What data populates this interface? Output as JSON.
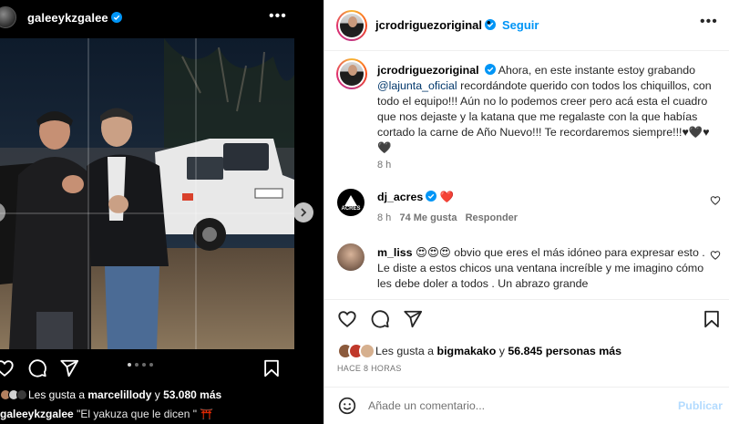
{
  "colors": {
    "link": "#0095f6",
    "heart": "#ed4956",
    "text_secondary": "#737373",
    "mention": "#00376b"
  },
  "left_post": {
    "username": "galeeykzgalee",
    "verified": true,
    "more_icon": "more-horizontal-icon",
    "likes_prefix": "Les gusta a",
    "likes_user": "marcelillody",
    "likes_mid": "y",
    "likes_count": "53.080 más",
    "caption_user": "galeeykzgalee",
    "caption_text": "\"El yakuza que le dicen \" ⛩️",
    "icons": [
      "heart-icon",
      "comment-icon",
      "share-icon",
      "bookmark-icon"
    ]
  },
  "post": {
    "username": "jcrodriguezoriginal",
    "verified": true,
    "separator": "•",
    "follow_label": "Seguir",
    "more_icon": "more-horizontal-icon",
    "caption_user": "jcrodriguezoriginal",
    "caption_part1": "Ahora, en este instante estoy grabando",
    "caption_mention": "@lajunta_oficial",
    "caption_part2": "recordándote querido con todos los chiquillos, con todo el equipo!!! Aún no lo podemos creer pero acá esta el cuadro que nos dejaste y la katana que me regalaste con la que habías cortado la carne de Año Nuevo!!! Te recordaremos siempre!!!♥🖤♥🖤",
    "caption_time": "8 h"
  },
  "comments": [
    {
      "user": "dj_acres",
      "verified": true,
      "text": "❤️",
      "time": "8 h",
      "likes": "74 Me gusta",
      "reply": "Responder",
      "avatar_text": "ACRES"
    },
    {
      "user": "m_liss",
      "text": "😍😍😍 obvio que eres el más idóneo para expresar esto . Le diste a estos chicos una ventana increíble y me imagino cómo les debe doler a todos . Un abrazo grande"
    }
  ],
  "footer": {
    "likes_prefix": "Les gusta a",
    "likes_user": "bigmakako",
    "likes_mid": "y",
    "likes_count": "56.845 personas más",
    "timestamp": "HACE 8 HORAS",
    "comment_placeholder": "Añade un comentario...",
    "publish_label": "Publicar",
    "emoji_icon": "emoji-smiley-icon"
  }
}
